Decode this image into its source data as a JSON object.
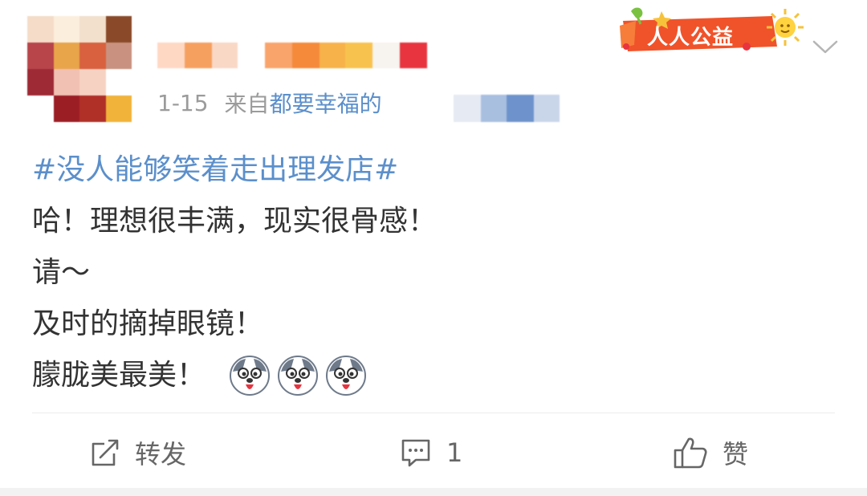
{
  "post": {
    "badge": {
      "label": "人人公益",
      "icon": "sun-icon"
    },
    "date": "1-15",
    "source_prefix": "来自",
    "source_app": "都要幸福的",
    "lines": {
      "topic": "#没人能够笑着走出理发店#",
      "l1": "哈！理想很丰满，现实很骨感！",
      "l2": "请～",
      "l3": "及时的摘掉眼镜！",
      "l4": "朦胧美最美！"
    },
    "emoji_count": 3,
    "emoji_icon": "husky-tongue-emoji"
  },
  "actions": {
    "repost_label": "转发",
    "comment_count": "1",
    "like_label": "赞"
  },
  "colors": {
    "link_blue": "#5b8fcb",
    "text": "#333333",
    "muted": "#9b9b9b",
    "badge_orange": "#f0532a"
  }
}
